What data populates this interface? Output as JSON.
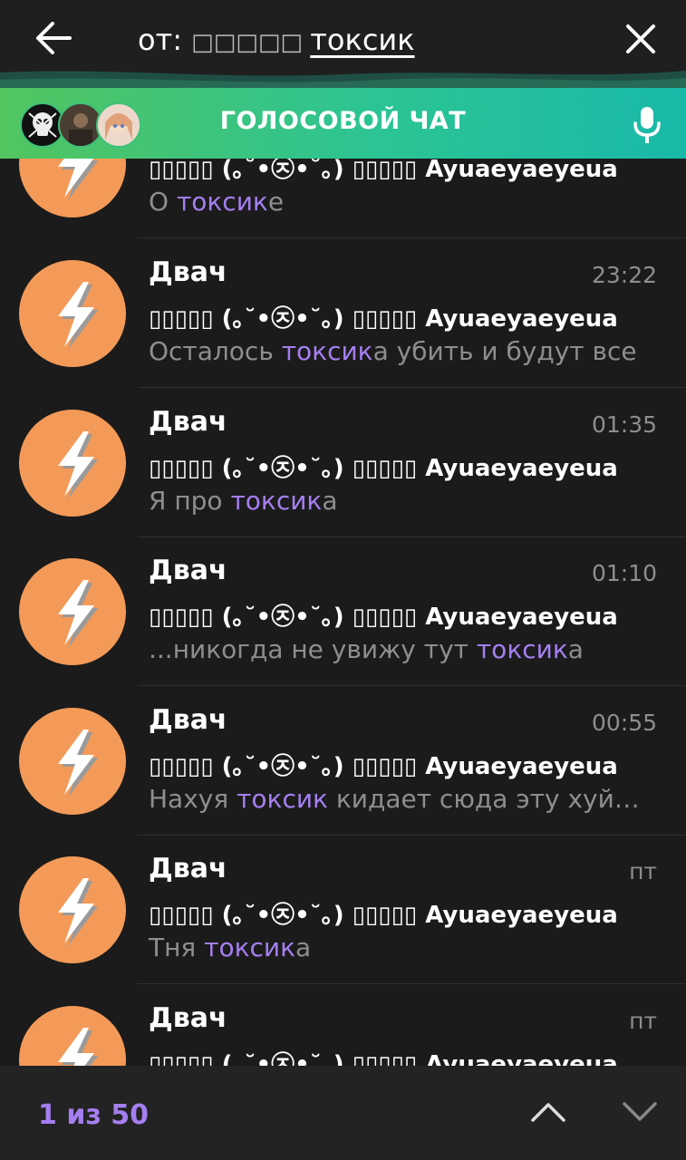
{
  "search": {
    "prefix": "от: ",
    "sender_placeholder_glyphs": "□□□□□ ",
    "query": "токсик"
  },
  "voice_chat": {
    "label": "ГОЛОСОВОЙ ЧАТ"
  },
  "results": [
    {
      "name": "",
      "time": "",
      "sender": "▯▯▯▯▯ (｡˘•㉨•˘｡) ▯▯▯▯▯ Ayuaeyaeyeua",
      "before": "О ",
      "match": "токсик",
      "after": "е"
    },
    {
      "name": "Двач",
      "time": "23:22",
      "sender": "▯▯▯▯▯ (｡˘•㉨•˘｡) ▯▯▯▯▯ Ayuaeyaeyeua",
      "before": "Осталось ",
      "match": "токсик",
      "after": "а убить и будут все"
    },
    {
      "name": "Двач",
      "time": "01:35",
      "sender": "▯▯▯▯▯ (｡˘•㉨•˘｡) ▯▯▯▯▯ Ayuaeyaeyeua",
      "before": "Я про ",
      "match": "токсик",
      "after": "а"
    },
    {
      "name": "Двач",
      "time": "01:10",
      "sender": "▯▯▯▯▯ (｡˘•㉨•˘｡) ▯▯▯▯▯ Ayuaeyaeyeua",
      "before": "...никогда не увижу тут ",
      "match": "токсик",
      "after": "а"
    },
    {
      "name": "Двач",
      "time": "00:55",
      "sender": "▯▯▯▯▯ (｡˘•㉨•˘｡) ▯▯▯▯▯ Ayuaeyaeyeua",
      "before": "Нахуя ",
      "match": "токсик",
      "after": " кидает сюда эту хуй…"
    },
    {
      "name": "Двач",
      "time": "пт",
      "sender": "▯▯▯▯▯ (｡˘•㉨•˘｡) ▯▯▯▯▯ Ayuaeyaeyeua",
      "before": "Тня ",
      "match": "токсик",
      "after": "а"
    },
    {
      "name": "Двач",
      "time": "пт",
      "sender": "▯▯▯▯▯ (｡˘•㉨•˘｡) ▯▯▯▯▯ Ayuaeyaeyeua",
      "before": "",
      "match": "",
      "after": ""
    }
  ],
  "navigation": {
    "counter": "1 из 50"
  },
  "colors": {
    "accent": "#a57ff1",
    "avatar": "#f49a58",
    "voice_start": "#52c55f",
    "voice_end": "#19b9a9",
    "background": "#1b1b1b"
  }
}
